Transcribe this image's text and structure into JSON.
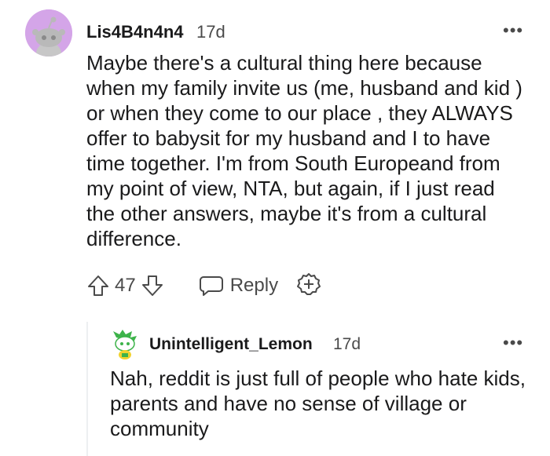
{
  "comment": {
    "username": "Lis4B4n4n4",
    "age": "17d",
    "more": "•••",
    "body": "Maybe there's a cultural thing here because when my family invite us (me, husband and kid ) or when they come to our place , they ALWAYS offer to babysit for my husband and I to have time together. I'm from South Europeand from my point of view, NTA, but again, if I just read the other answers, maybe it's from a cultural difference.",
    "score": "47",
    "reply_label": "Reply",
    "avatar_color": "#d4a5e8"
  },
  "reply": {
    "username": "Unintelligent_Lemon",
    "age": "17d",
    "more": "•••",
    "body": "Nah, reddit is just full of people who hate kids, parents and have no sense of village or community"
  }
}
